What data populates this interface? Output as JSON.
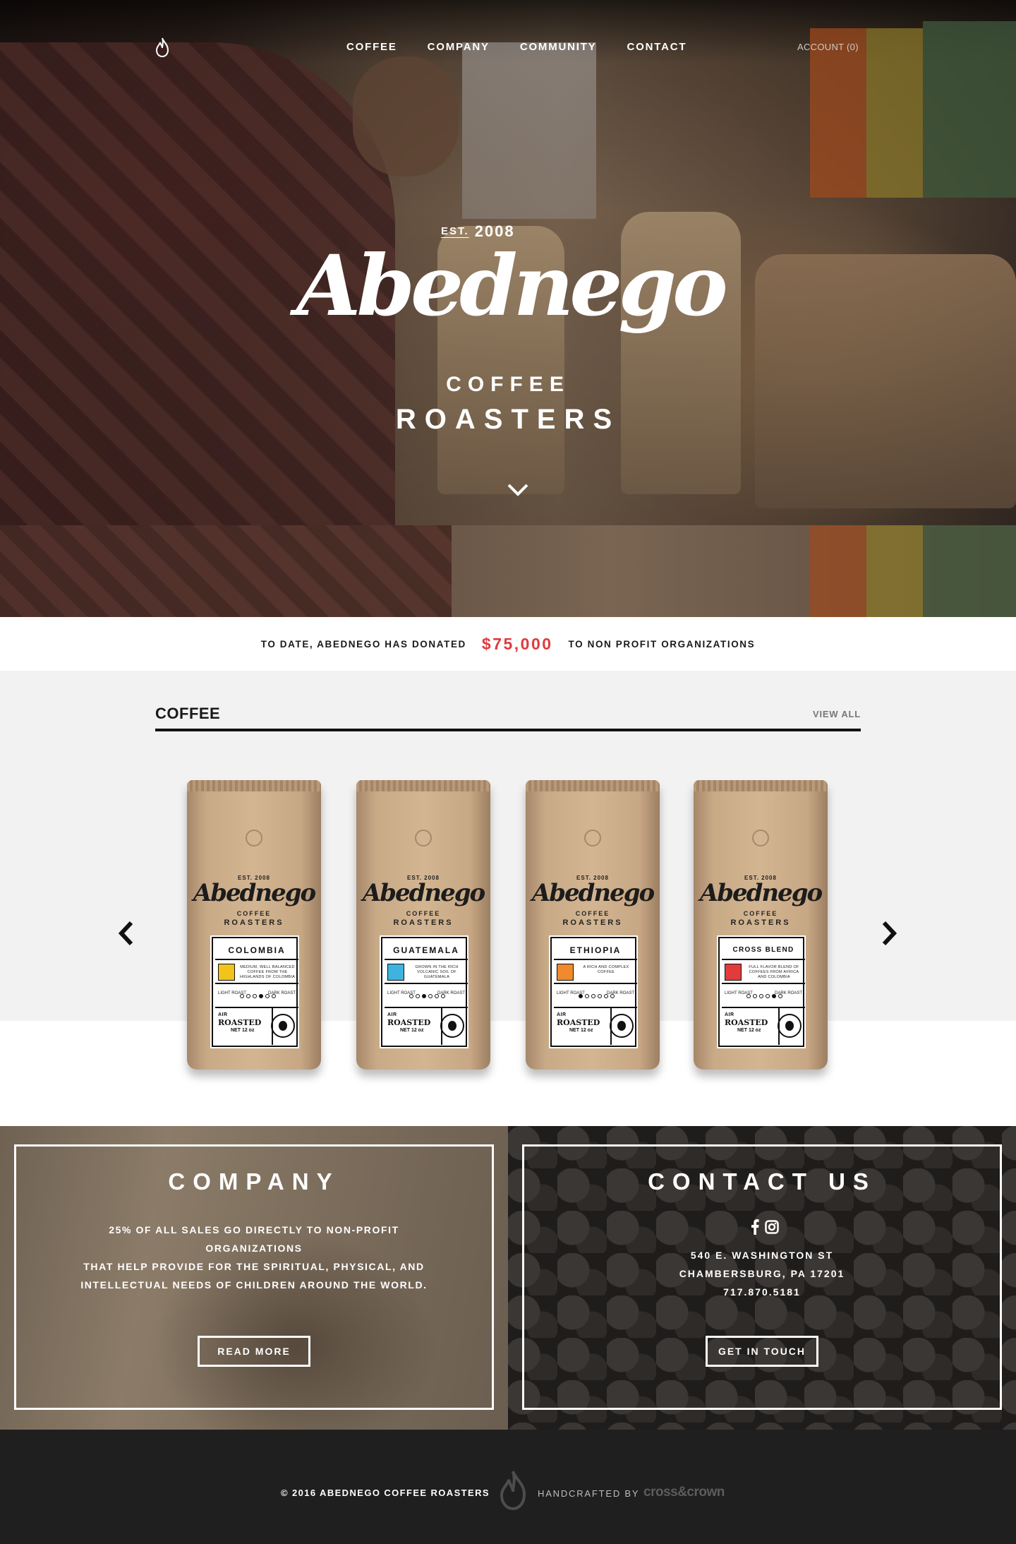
{
  "nav": {
    "items": [
      "COFFEE",
      "COMPANY",
      "COMMUNITY",
      "CONTACT"
    ],
    "account": "ACCOUNT (0)",
    "logo_icon": "flame-icon"
  },
  "hero": {
    "est": "EST.",
    "year": "2008",
    "script": "Abednego",
    "coffee": "COFFEE",
    "roasters": "ROASTERS",
    "scroll_icon": "chevron-down-icon"
  },
  "donation": {
    "prefix": "TO DATE, ABEDNEGO HAS DONATED",
    "amount": "$75,000",
    "suffix": "TO NON PROFIT ORGANIZATIONS",
    "amount_color": "#e03a3e"
  },
  "coffee": {
    "title": "COFFEE",
    "view_all": "VIEW ALL",
    "prev_icon": "chevron-left-icon",
    "next_icon": "chevron-right-icon",
    "bag_brand": {
      "est": "EST. 2008",
      "script": "Abednego",
      "coffee": "COFFEE",
      "roasters": "ROASTERS",
      "light": "LIGHT ROAST",
      "dark": "DARK ROAST",
      "air": "AIR",
      "roasted": "ROASTED",
      "net": "NET 12 oz"
    },
    "products": [
      {
        "name": "COLOMBIA",
        "desc": "MEDIUM, WELL BALANCED COFFEE FROM THE HIGHLANDS OF COLOMBIA",
        "color": "#f2c31a",
        "roast_level": 4
      },
      {
        "name": "GUATEMALA",
        "desc": "GROWN IN THE RICH VOLCANIC SOIL OF GUATEMALA",
        "color": "#3eb3e0",
        "roast_level": 3
      },
      {
        "name": "ETHIOPIA",
        "desc": "A RICH AND COMPLEX COFFEE",
        "color": "#f08a2c",
        "roast_level": 1
      },
      {
        "name": "CROSS BLEND",
        "desc": "FULL FLAVOR BLEND OF COFFEES FROM AFRICA AND COLOMBIA",
        "color": "#e23b3b",
        "roast_level": 5
      }
    ]
  },
  "company": {
    "title": "COMPANY",
    "text": [
      "25% OF ALL SALES GO DIRECTLY TO NON-PROFIT",
      "ORGANIZATIONS",
      "THAT HELP PROVIDE FOR THE SPIRITUAL, PHYSICAL, AND",
      "INTELLECTUAL NEEDS OF CHILDREN AROUND THE WORLD."
    ],
    "button": "READ MORE"
  },
  "contact": {
    "title": "CONTACT US",
    "address": [
      "540 E. WASHINGTON ST",
      "CHAMBERSBURG, PA 17201",
      "717.870.5181"
    ],
    "button": "GET IN TOUCH",
    "icons": [
      "facebook-icon",
      "instagram-icon"
    ]
  },
  "footer": {
    "copyright": "© 2016 ABEDNEGO COFFEE ROASTERS",
    "handcrafted": "HANDCRAFTED BY",
    "agency": "cross&crown"
  }
}
